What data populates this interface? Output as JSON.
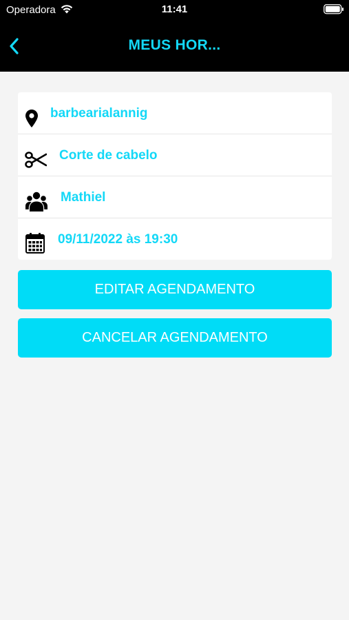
{
  "status_bar": {
    "carrier": "Operadora",
    "time": "11:41",
    "wifi_icon": "wifi-icon",
    "battery_icon": "battery-icon"
  },
  "nav": {
    "title": "MEUS HOR...",
    "back_icon": "chevron-left-icon"
  },
  "appointment": {
    "location": {
      "icon": "map-pin-icon",
      "text": "barbearialannig"
    },
    "service": {
      "icon": "scissors-icon",
      "text": "Corte de cabelo"
    },
    "professional": {
      "icon": "users-icon",
      "text": "Mathiel"
    },
    "datetime": {
      "icon": "calendar-icon",
      "text": "09/11/2022 às 19:30"
    }
  },
  "actions": {
    "edit_label": "EDITAR AGENDAMENTO",
    "cancel_label": "CANCELAR AGENDAMENTO"
  },
  "colors": {
    "accent": "#13d8f7",
    "button": "#00dcf7",
    "header": "#000000",
    "background": "#f4f4f4"
  }
}
